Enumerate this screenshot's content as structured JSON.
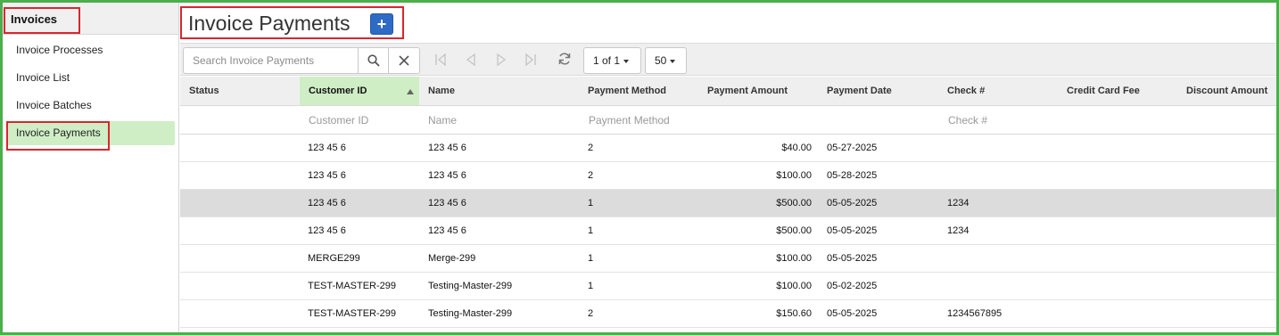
{
  "sidebar": {
    "title": "Invoices",
    "items": [
      {
        "label": "Invoice Processes"
      },
      {
        "label": "Invoice List"
      },
      {
        "label": "Invoice Batches"
      },
      {
        "label": "Invoice Payments"
      }
    ],
    "active_index": 3
  },
  "header": {
    "title": "Invoice Payments",
    "add_label": "+"
  },
  "toolbar": {
    "search_placeholder": "Search Invoice Payments",
    "page_label": "1 of 1",
    "page_size": "50"
  },
  "grid": {
    "columns": [
      {
        "label": "Status",
        "filter": ""
      },
      {
        "label": "Customer ID",
        "filter": "Customer ID",
        "sorted": "asc"
      },
      {
        "label": "Name",
        "filter": "Name"
      },
      {
        "label": "Payment Method",
        "filter": "Payment Method"
      },
      {
        "label": "Payment Amount",
        "filter": ""
      },
      {
        "label": "Payment Date",
        "filter": ""
      },
      {
        "label": "Check #",
        "filter": "Check #"
      },
      {
        "label": "Credit Card Fee",
        "filter": ""
      },
      {
        "label": "Discount Amount",
        "filter": ""
      }
    ],
    "rows": [
      {
        "status": "",
        "customer_id": "123 45 6",
        "name": "123 45 6",
        "method": "2",
        "amount": "$40.00",
        "date": "05-27-2025",
        "check": "",
        "cc_fee": "",
        "discount": ""
      },
      {
        "status": "",
        "customer_id": "123 45 6",
        "name": "123 45 6",
        "method": "2",
        "amount": "$100.00",
        "date": "05-28-2025",
        "check": "",
        "cc_fee": "",
        "discount": ""
      },
      {
        "status": "",
        "customer_id": "123 45 6",
        "name": "123 45 6",
        "method": "1",
        "amount": "$500.00",
        "date": "05-05-2025",
        "check": "1234",
        "cc_fee": "",
        "discount": "",
        "selected": true
      },
      {
        "status": "",
        "customer_id": "123 45 6",
        "name": "123 45 6",
        "method": "1",
        "amount": "$500.00",
        "date": "05-05-2025",
        "check": "1234",
        "cc_fee": "",
        "discount": ""
      },
      {
        "status": "",
        "customer_id": "MERGE299",
        "name": "Merge-299",
        "method": "1",
        "amount": "$100.00",
        "date": "05-05-2025",
        "check": "",
        "cc_fee": "",
        "discount": ""
      },
      {
        "status": "",
        "customer_id": "TEST-MASTER-299",
        "name": "Testing-Master-299",
        "method": "1",
        "amount": "$100.00",
        "date": "05-02-2025",
        "check": "",
        "cc_fee": "",
        "discount": ""
      },
      {
        "status": "",
        "customer_id": "TEST-MASTER-299",
        "name": "Testing-Master-299",
        "method": "2",
        "amount": "$150.60",
        "date": "05-05-2025",
        "check": "1234567895",
        "cc_fee": "",
        "discount": ""
      }
    ]
  },
  "colors": {
    "frame": "#4cae4c",
    "highlight": "#d9262e",
    "active_bg": "#cfeec5",
    "add_button": "#2e6bc4",
    "selected_row": "#dcdcdc"
  },
  "icons": {
    "search": "search-icon",
    "clear": "close-icon",
    "first": "first-page-icon",
    "prev": "prev-page-icon",
    "next": "next-page-icon",
    "last": "last-page-icon",
    "refresh": "refresh-icon"
  }
}
